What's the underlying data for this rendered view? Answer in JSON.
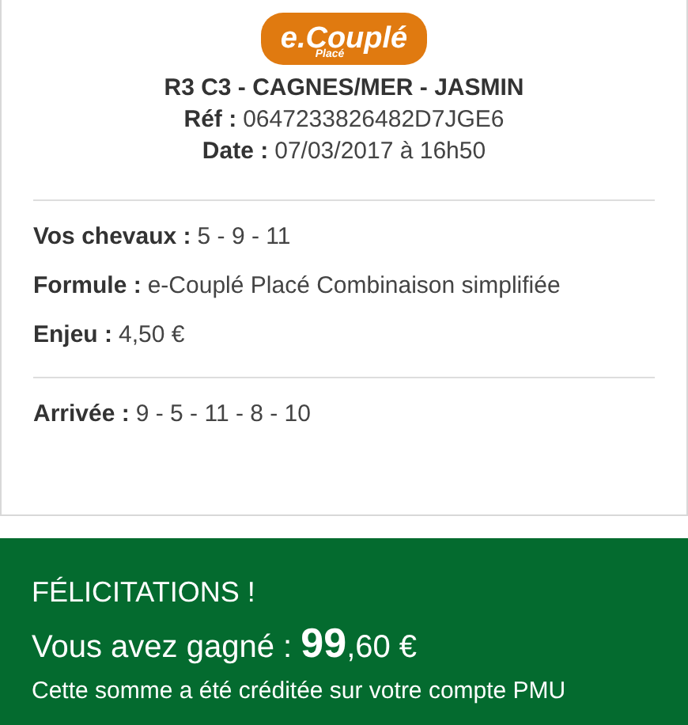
{
  "logo": {
    "main": "e.Couplé",
    "sub": "Placé"
  },
  "race_title": "R3 C3 - CAGNES/MER - JASMIN",
  "header_fields": [
    {
      "label": "Réf :",
      "value": "0647233826482D7JGE6"
    },
    {
      "label": "Date :",
      "value": "07/03/2017 à 16h50"
    }
  ],
  "bet_fields": [
    {
      "label": "Vos chevaux :",
      "value": "5 - 9 - 11"
    },
    {
      "label": "Formule :",
      "value": "e-Couplé Placé Combinaison simplifiée"
    },
    {
      "label": "Enjeu :",
      "value": "4,50 €"
    }
  ],
  "result_fields": [
    {
      "label": "Arrivée :",
      "value": "9 - 5 - 11 - 8 - 10"
    }
  ],
  "banner": {
    "title": "FÉLICITATIONS !",
    "gain": "Vous avez gagné : **99**,60 €",
    "note": "Cette somme a été créditée sur votre compte PMU"
  }
}
